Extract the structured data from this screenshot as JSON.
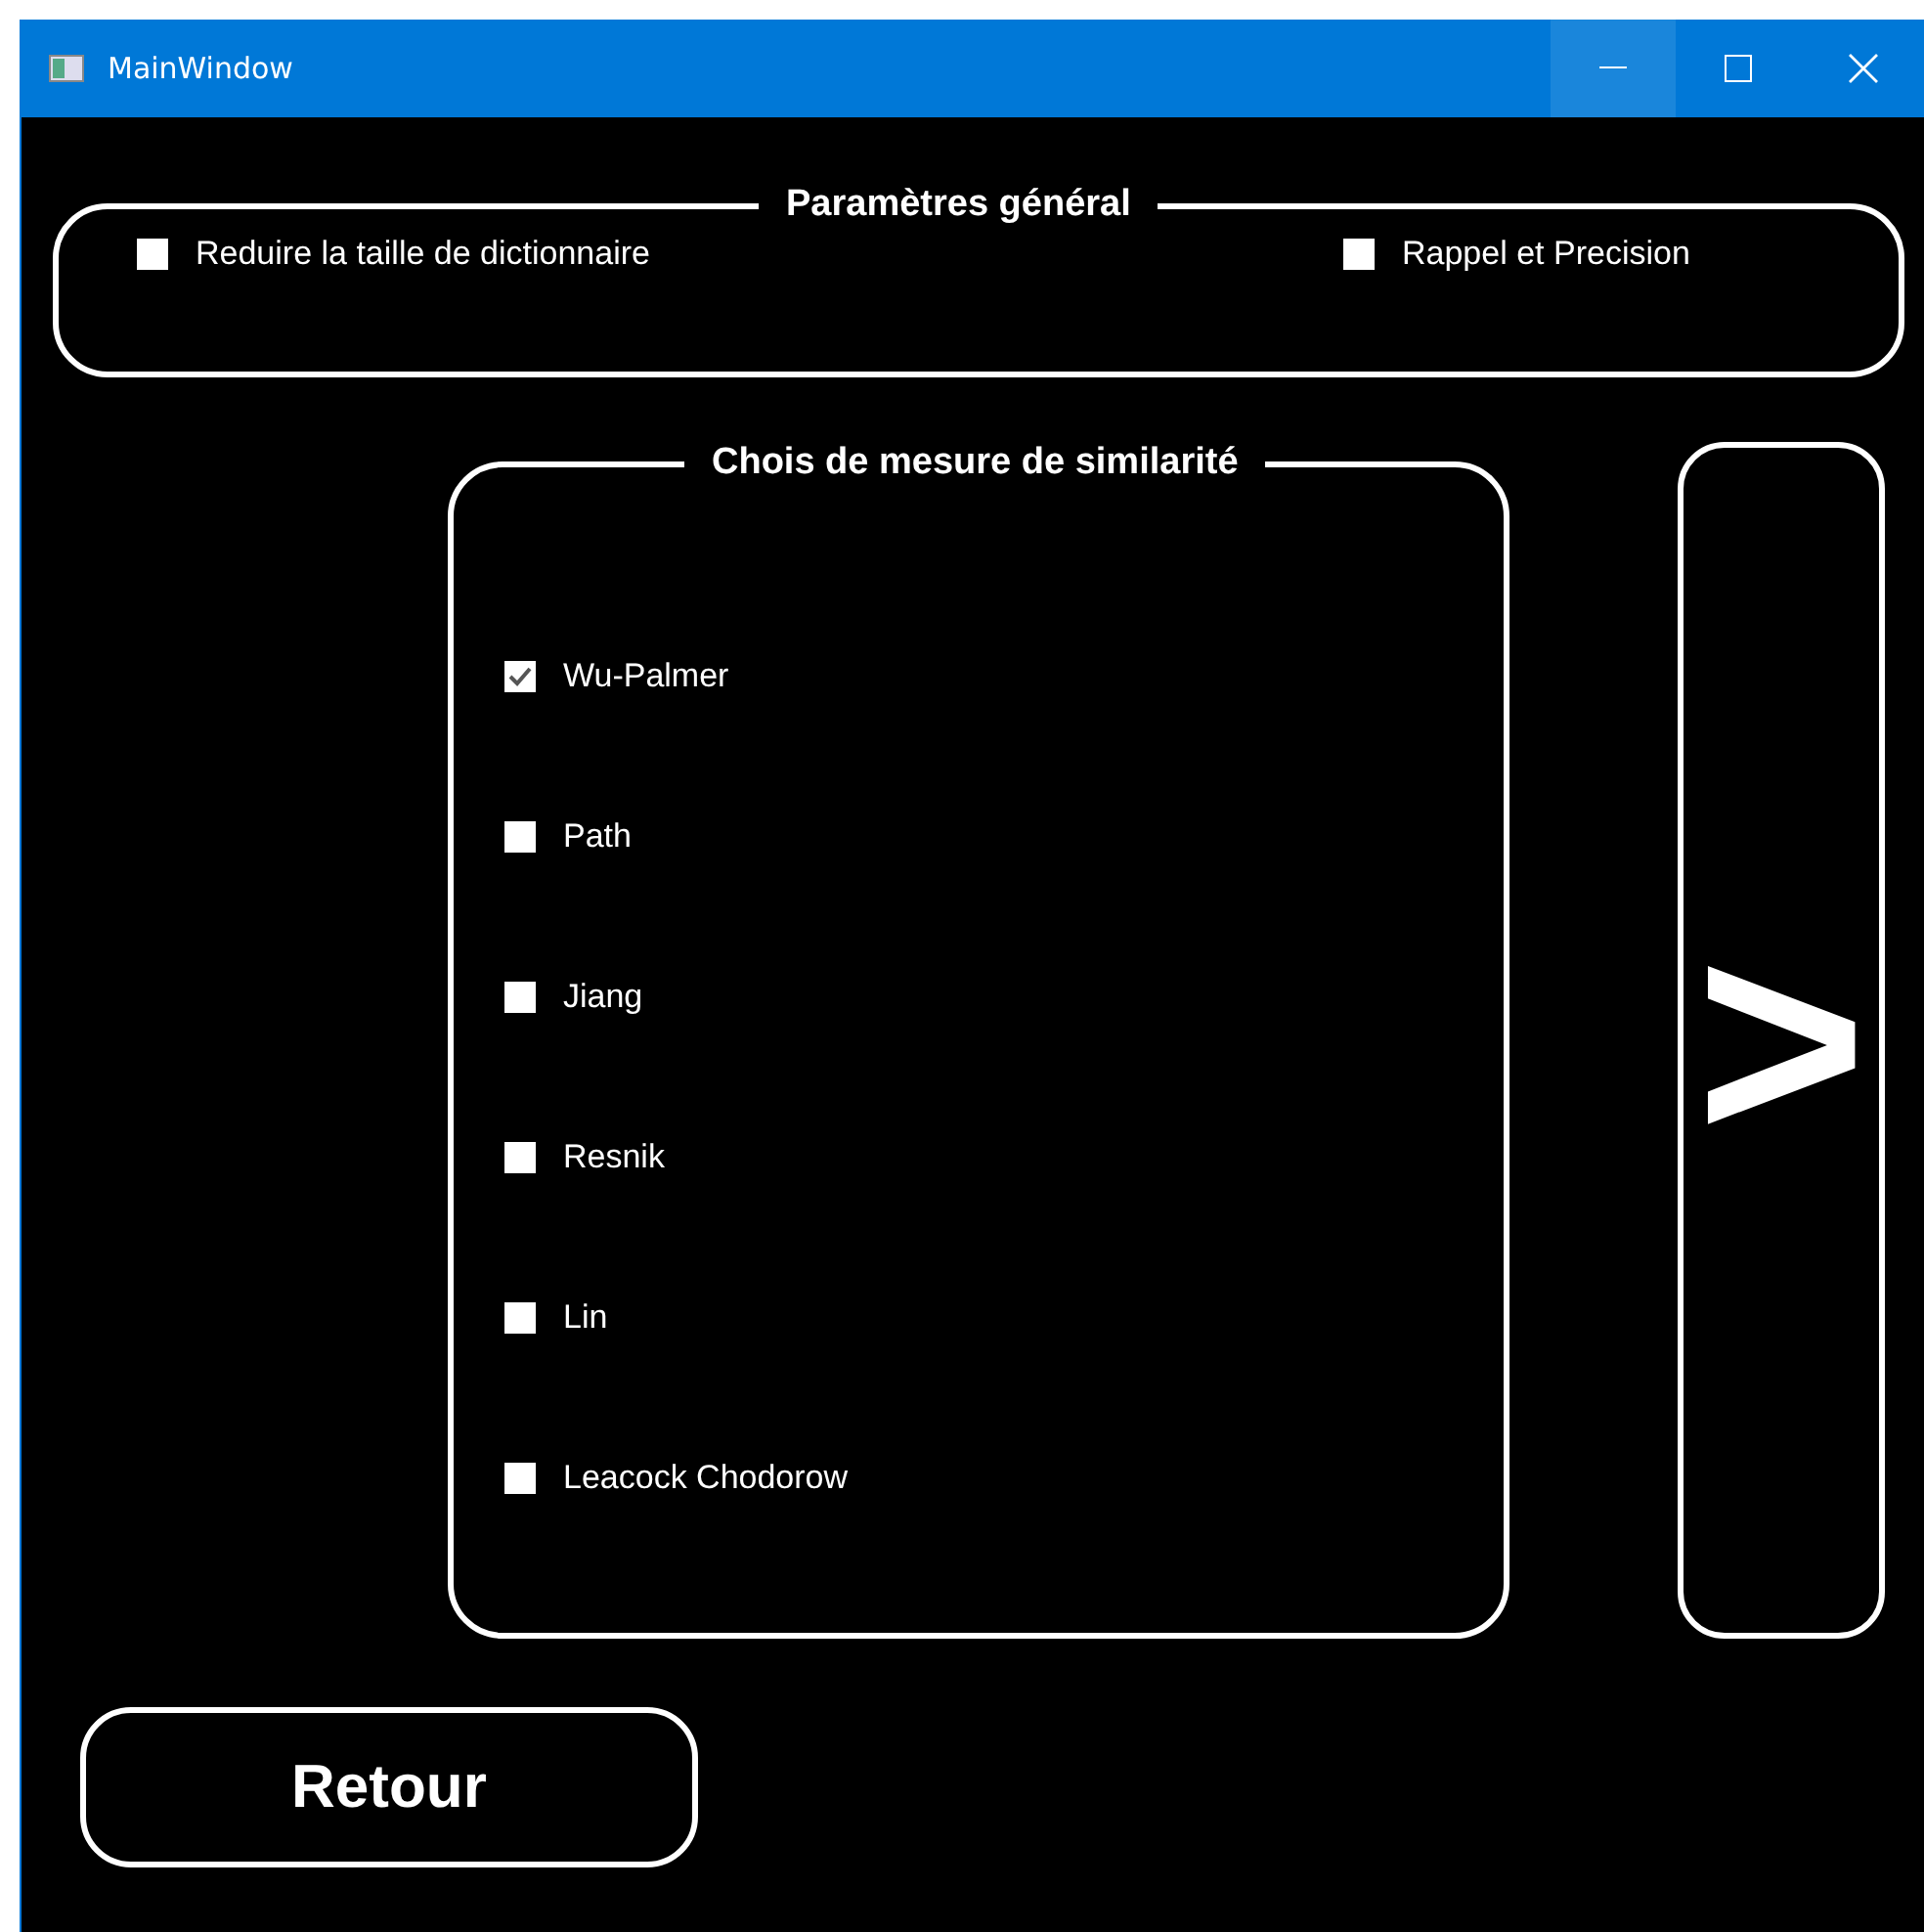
{
  "window": {
    "title": "MainWindow"
  },
  "general": {
    "title": "Paramètres général",
    "options": [
      {
        "label": "Reduire la taille de dictionnaire",
        "checked": false
      },
      {
        "label": "Rappel et Precision",
        "checked": false
      }
    ]
  },
  "similarity": {
    "title": "Chois de mesure de similarité",
    "options": [
      {
        "label": "Wu-Palmer",
        "checked": true
      },
      {
        "label": "Path",
        "checked": false
      },
      {
        "label": "Jiang",
        "checked": false
      },
      {
        "label": "Resnik",
        "checked": false
      },
      {
        "label": "Lin",
        "checked": false
      },
      {
        "label": "Leacock Chodorow",
        "checked": false
      }
    ]
  },
  "next_button": {
    "label": ">"
  },
  "back_button": {
    "label": "Retour"
  }
}
